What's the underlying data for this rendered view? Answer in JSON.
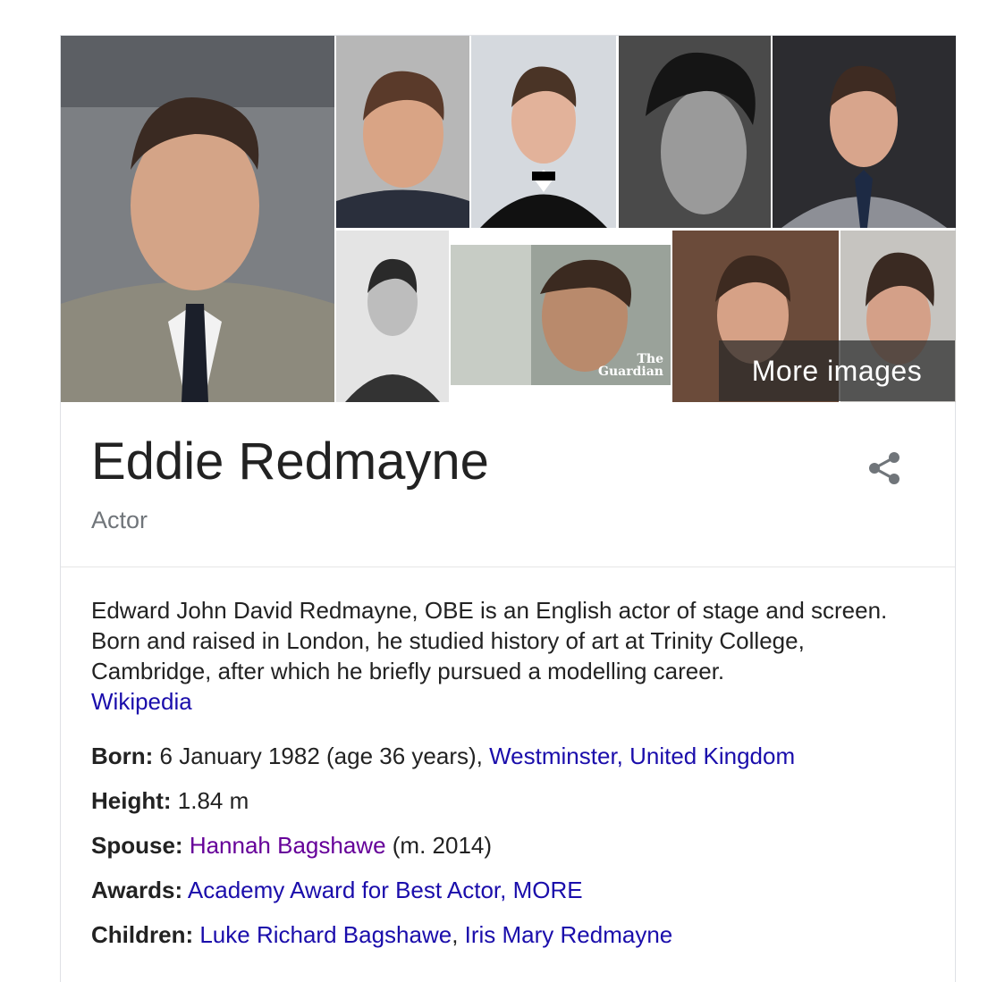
{
  "gallery": {
    "watermark_text": "The Guardian",
    "more_images_label": "More images"
  },
  "entity": {
    "name": "Eddie Redmayne",
    "type": "Actor",
    "share_icon": "share-icon"
  },
  "description": {
    "text": "Edward John David Redmayne, OBE is an English actor of stage and screen. Born and raised in London, he studied history of art at Trinity College, Cambridge, after which he briefly pursued a modelling career.",
    "source_link": "Wikipedia"
  },
  "facts": {
    "born": {
      "label": "Born:",
      "value": " 6 January 1982 (age 36 years), ",
      "link": "Westminster, United Kingdom"
    },
    "height": {
      "label": "Height:",
      "value": " 1.84 m"
    },
    "spouse": {
      "label": "Spouse:",
      "link": "Hannah Bagshawe",
      "value": " (m. 2014)"
    },
    "awards": {
      "label": "Awards:",
      "link": "Academy Award for Best Actor",
      "sep": ", ",
      "more": "MORE"
    },
    "children": {
      "label": "Children:",
      "link1": "Luke Richard Bagshawe",
      "sep": ", ",
      "link2": "Iris Mary Redmayne"
    }
  },
  "colors": {
    "link": "#1a0dab",
    "visited_link": "#660099",
    "secondary_text": "#70757a"
  }
}
